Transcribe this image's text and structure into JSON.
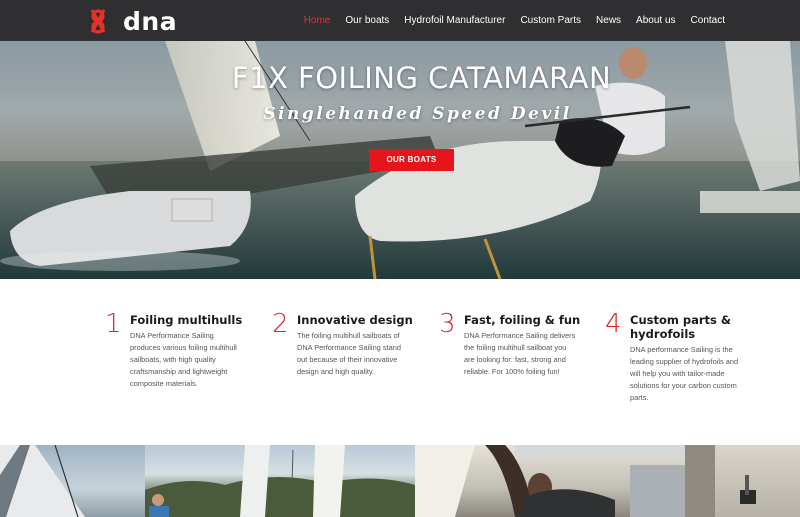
{
  "brand": {
    "name": "dna",
    "accent": "#e4322b"
  },
  "nav": {
    "items": [
      {
        "label": "Home",
        "active": true
      },
      {
        "label": "Our boats",
        "active": false
      },
      {
        "label": "Hydrofoil Manufacturer",
        "active": false
      },
      {
        "label": "Custom Parts",
        "active": false
      },
      {
        "label": "News",
        "active": false
      },
      {
        "label": "About us",
        "active": false
      },
      {
        "label": "Contact",
        "active": false
      }
    ]
  },
  "hero": {
    "title": "F1X FOILING CATAMARAN",
    "subtitle": "Singlehanded Speed Devil",
    "button_label": "OUR BOATS"
  },
  "features": [
    {
      "number": "1",
      "title": "Foiling multihulls",
      "description": "DNA Performance Sailing produces various foiling multihull sailboats, with high quality craftsmanship and lightweight composite materials."
    },
    {
      "number": "2",
      "title": "Innovative design",
      "description": "The foiling multihull sailboats of DNA Performance Sailing stand out because of their innovative design and high quality."
    },
    {
      "number": "3",
      "title": "Fast, foiling & fun",
      "description": "DNA Performance Sailing delivers the foiling multihull sailboat you are looking for: fast, strong and reliable. For 100% foiling fun!"
    },
    {
      "number": "4",
      "title": "Custom parts & hydrofoils",
      "description": "DNA performance Sailing is the leading supplier of hydrofoils and will help you with tailor-made solutions for your carbon custom parts."
    }
  ]
}
